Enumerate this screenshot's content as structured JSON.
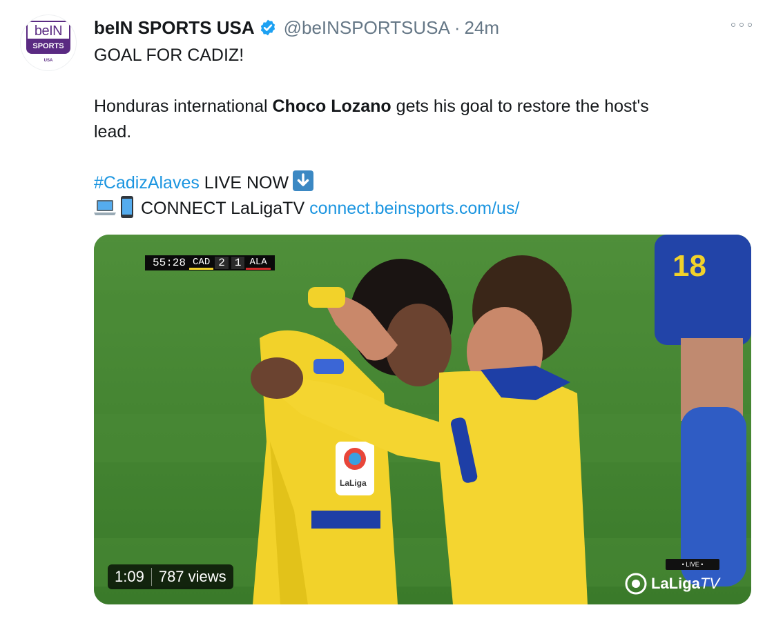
{
  "tweet": {
    "account": {
      "display_name": "beIN SPORTS USA",
      "handle": "@beINSPORTSUSA",
      "separator": "·",
      "time": "24m",
      "avatar": {
        "logo_top": "beIN",
        "logo_bottom": "SPORTS",
        "logo_small": "USA"
      },
      "verified": true
    },
    "more_icon": "more-horizontal-icon",
    "body": {
      "line1": "GOAL FOR CADIZ!",
      "line2_prefix": "Honduras international ",
      "line2_bold": "Choco Lozano",
      "line2_suffix": " gets his goal to restore the host's",
      "line3": "lead.",
      "hashtag": "#CadizAlaves",
      "live_text": " LIVE NOW",
      "connect_text": "CONNECT LaLigaTV ",
      "link": "connect.beinsports.com/us/"
    },
    "media": {
      "scoreboard": {
        "clock": "55:28",
        "home": "CAD",
        "home_score": "2",
        "away_score": "1",
        "away": "ALA"
      },
      "duration": "1:09",
      "views": "787 views",
      "live_tag": "• LIVE •",
      "broadcaster": "LaLiga",
      "broadcaster_suffix": "TV"
    }
  },
  "colors": {
    "link": "#1b95e0",
    "verified": "#1da1f2",
    "brand_purple": "#5a2a82",
    "text": "#14171a",
    "muted": "#657786"
  }
}
